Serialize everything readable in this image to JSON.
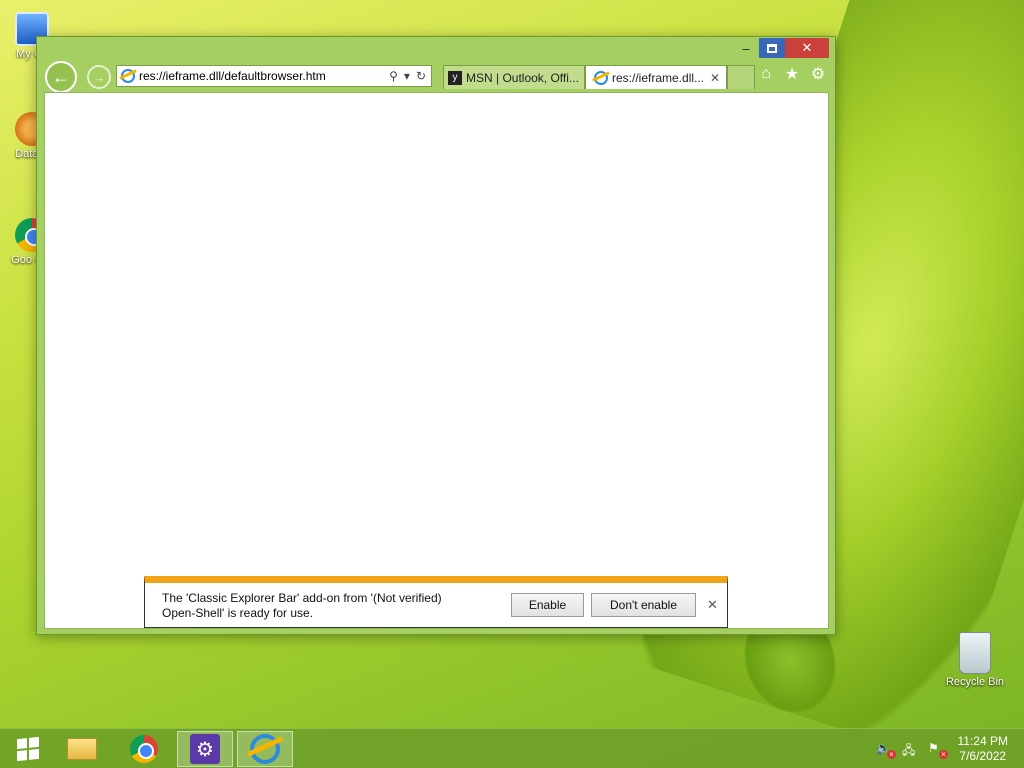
{
  "desktop": {
    "icons": [
      {
        "label": "My Co"
      },
      {
        "label": "DataW"
      },
      {
        "label": "Goo Chr"
      },
      {
        "label": "Recycle Bin"
      }
    ]
  },
  "window": {
    "controls": {
      "minimize": "‒",
      "close": "✕"
    },
    "address_bar": {
      "url": "res://ieframe.dll/defaultbrowser.htm",
      "search_icon": "⚲",
      "dropdown_icon": "▾",
      "refresh_icon": "↻"
    },
    "tabs": [
      {
        "label": "MSN | Outlook, Offi...",
        "icon": "msn-icon"
      },
      {
        "label": "res://ieframe.dll...",
        "icon": "ie-icon",
        "close": "✕"
      }
    ],
    "commands": {
      "home": "⌂",
      "favorites": "★",
      "tools": "⚙"
    }
  },
  "notification": {
    "message_line1": "The 'Classic Explorer Bar' add-on from '(Not verified)",
    "message_line2": "Open-Shell' is ready for use.",
    "enable_label": "Enable",
    "dont_enable_label": "Don't enable",
    "close": "✕"
  },
  "taskbar": {
    "clock_time": "11:24 PM",
    "clock_date": "7/6/2022"
  },
  "colors": {
    "accent_orange": "#f0a416",
    "window_frame": "#a6cf62",
    "close_red": "#c9413a",
    "maximize_blue": "#3a68b8"
  }
}
